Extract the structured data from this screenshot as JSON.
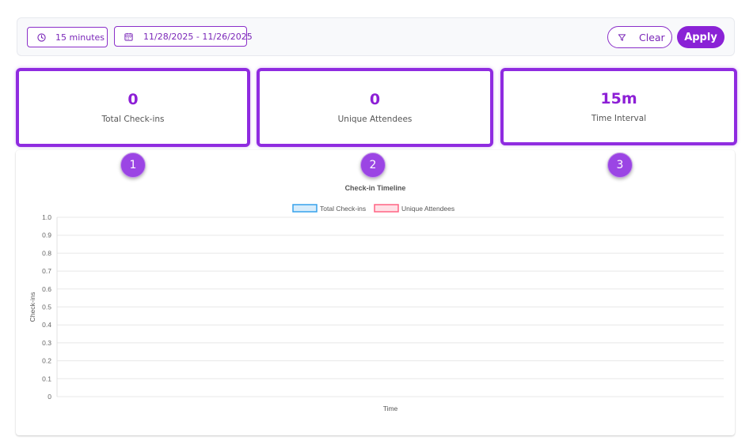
{
  "filters": {
    "interval_label": "15 minutes",
    "date_range_label": "11/28/2025 - 11/26/2025",
    "clear_label": "Clear",
    "apply_label": "Apply",
    "icons": {
      "interval": "clock-icon",
      "date": "calendar-icon",
      "clear": "filter-icon"
    }
  },
  "stats": [
    {
      "value": "0",
      "label": "Total Check-ins"
    },
    {
      "value": "0",
      "label": "Unique Attendees"
    },
    {
      "value": "15m",
      "label": "Time Interval"
    }
  ],
  "badges": [
    "1",
    "2",
    "3"
  ],
  "colors": {
    "accent": "#8a22d6",
    "card_border": "#8f2be0",
    "badge": "#9b45e4",
    "series_total": "#36a2eb",
    "series_unique": "#ff6384"
  },
  "chart_data": {
    "type": "line",
    "title": "Check-in Timeline",
    "xlabel": "Time",
    "ylabel": "Check-ins",
    "ylim": [
      0,
      1.0
    ],
    "yticks": [
      "0",
      "0.1",
      "0.2",
      "0.3",
      "0.4",
      "0.5",
      "0.6",
      "0.7",
      "0.8",
      "0.9",
      "1.0"
    ],
    "x": [],
    "series": [
      {
        "name": "Total Check-ins",
        "values": [],
        "color": "#36a2eb"
      },
      {
        "name": "Unique Attendees",
        "values": [],
        "color": "#ff6384"
      }
    ],
    "grid": true,
    "legend": "top-center"
  }
}
